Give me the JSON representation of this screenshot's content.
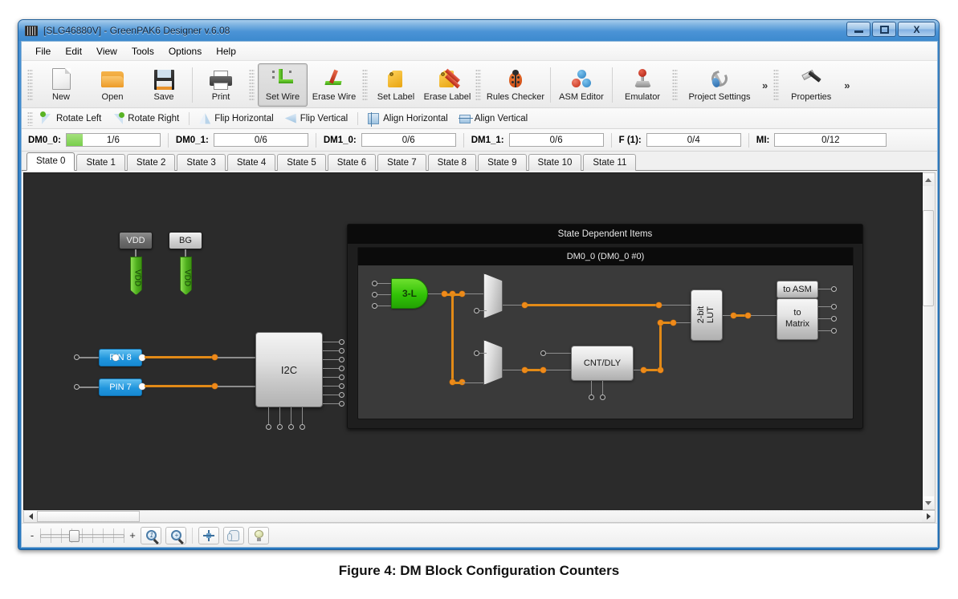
{
  "window": {
    "title": "[SLG46880V] - GreenPAK6 Designer v.6.08",
    "icon": "chip-icon",
    "minimize_label": "–",
    "maximize_label": "□",
    "close_label": "X"
  },
  "menu": {
    "items": [
      {
        "label": "File"
      },
      {
        "label": "Edit"
      },
      {
        "label": "View"
      },
      {
        "label": "Tools"
      },
      {
        "label": "Options"
      },
      {
        "label": "Help"
      }
    ]
  },
  "toolbar": {
    "buttons": [
      {
        "label": "New",
        "icon": "new-document-icon",
        "selected": false
      },
      {
        "label": "Open",
        "icon": "open-folder-icon",
        "selected": false
      },
      {
        "label": "Save",
        "icon": "floppy-disk-icon",
        "selected": false
      },
      {
        "label": "Print",
        "icon": "printer-icon",
        "selected": false
      },
      {
        "label": "Set Wire",
        "icon": "set-wire-icon",
        "selected": true
      },
      {
        "label": "Erase Wire",
        "icon": "erase-wire-icon",
        "selected": false
      },
      {
        "label": "Set Label",
        "icon": "set-label-icon",
        "selected": false
      },
      {
        "label": "Erase Label",
        "icon": "erase-label-icon",
        "selected": false
      },
      {
        "label": "Rules Checker",
        "icon": "ladybug-icon",
        "selected": false
      },
      {
        "label": "ASM Editor",
        "icon": "asm-circles-icon",
        "selected": false
      },
      {
        "label": "Emulator",
        "icon": "joystick-icon",
        "selected": false
      },
      {
        "label": "Project Settings",
        "icon": "wrench-screwdriver-icon",
        "selected": false
      }
    ],
    "overflow_label": "»",
    "properties": {
      "label": "Properties",
      "icon": "hammer-icon"
    },
    "overflow_right_label": "»"
  },
  "toolbar2": {
    "buttons": [
      {
        "label": "Rotate Left",
        "icon": "rotate-left-icon"
      },
      {
        "label": "Rotate Right",
        "icon": "rotate-right-icon"
      },
      {
        "label": "Flip Horizontal",
        "icon": "flip-horizontal-icon"
      },
      {
        "label": "Flip Vertical",
        "icon": "flip-vertical-icon"
      },
      {
        "label": "Align Horizontal",
        "icon": "align-horizontal-icon"
      },
      {
        "label": "Align Vertical",
        "icon": "align-vertical-icon"
      }
    ]
  },
  "counters": {
    "accent_fill": "#79cf4c",
    "items": [
      {
        "name": "DM0_0:",
        "value": "1/6",
        "used": 1,
        "total": 6,
        "fill_pct": 17
      },
      {
        "name": "DM0_1:",
        "value": "0/6",
        "used": 0,
        "total": 6,
        "fill_pct": 0
      },
      {
        "name": "DM1_0:",
        "value": "0/6",
        "used": 0,
        "total": 6,
        "fill_pct": 0
      },
      {
        "name": "DM1_1:",
        "value": "0/6",
        "used": 0,
        "total": 6,
        "fill_pct": 0
      },
      {
        "name": "F (1):",
        "value": "0/4",
        "used": 0,
        "total": 4,
        "fill_pct": 0
      },
      {
        "name": "MI:",
        "value": "0/12",
        "used": 0,
        "total": 12,
        "fill_pct": 0
      }
    ]
  },
  "state_tabs": {
    "active_index": 0,
    "items": [
      {
        "label": "State 0"
      },
      {
        "label": "State 1"
      },
      {
        "label": "State 2"
      },
      {
        "label": "State 3"
      },
      {
        "label": "State 4"
      },
      {
        "label": "State 5"
      },
      {
        "label": "State 6"
      },
      {
        "label": "State 7"
      },
      {
        "label": "State 8"
      },
      {
        "label": "State 9"
      },
      {
        "label": "State 10"
      },
      {
        "label": "State 11"
      }
    ]
  },
  "canvas": {
    "background": "#2b2b2b",
    "wire_color": "#e28a17",
    "blocks": {
      "vdd_block": "VDD",
      "bg_block": "BG",
      "vdd_tag_1": "VDD",
      "vdd_tag_2": "VDD",
      "pin8": "PIN 8",
      "pin7": "PIN 7",
      "i2c": "I2C"
    },
    "panel": {
      "title": "State Dependent Items",
      "inner_title": "DM0_0 (DM0_0 #0)",
      "gate": "3-L",
      "counter_delay": "CNT/DLY",
      "lut": "2-bit\nLUT",
      "lut_line1": "2-bit",
      "lut_line2": "LUT",
      "to_asm": "to ASM",
      "to_matrix_line1": "to",
      "to_matrix_line2": "Matrix"
    }
  },
  "bottom_bar": {
    "zoom_out_label": "-",
    "zoom_in_label": "+",
    "buttons": [
      {
        "icon": "zoom-one-to-one-icon"
      },
      {
        "icon": "zoom-fit-icon"
      },
      {
        "icon": "pan-icon"
      },
      {
        "icon": "hand-icon"
      },
      {
        "icon": "lightbulb-icon"
      }
    ]
  },
  "caption": "Figure 4: DM Block Configuration Counters"
}
